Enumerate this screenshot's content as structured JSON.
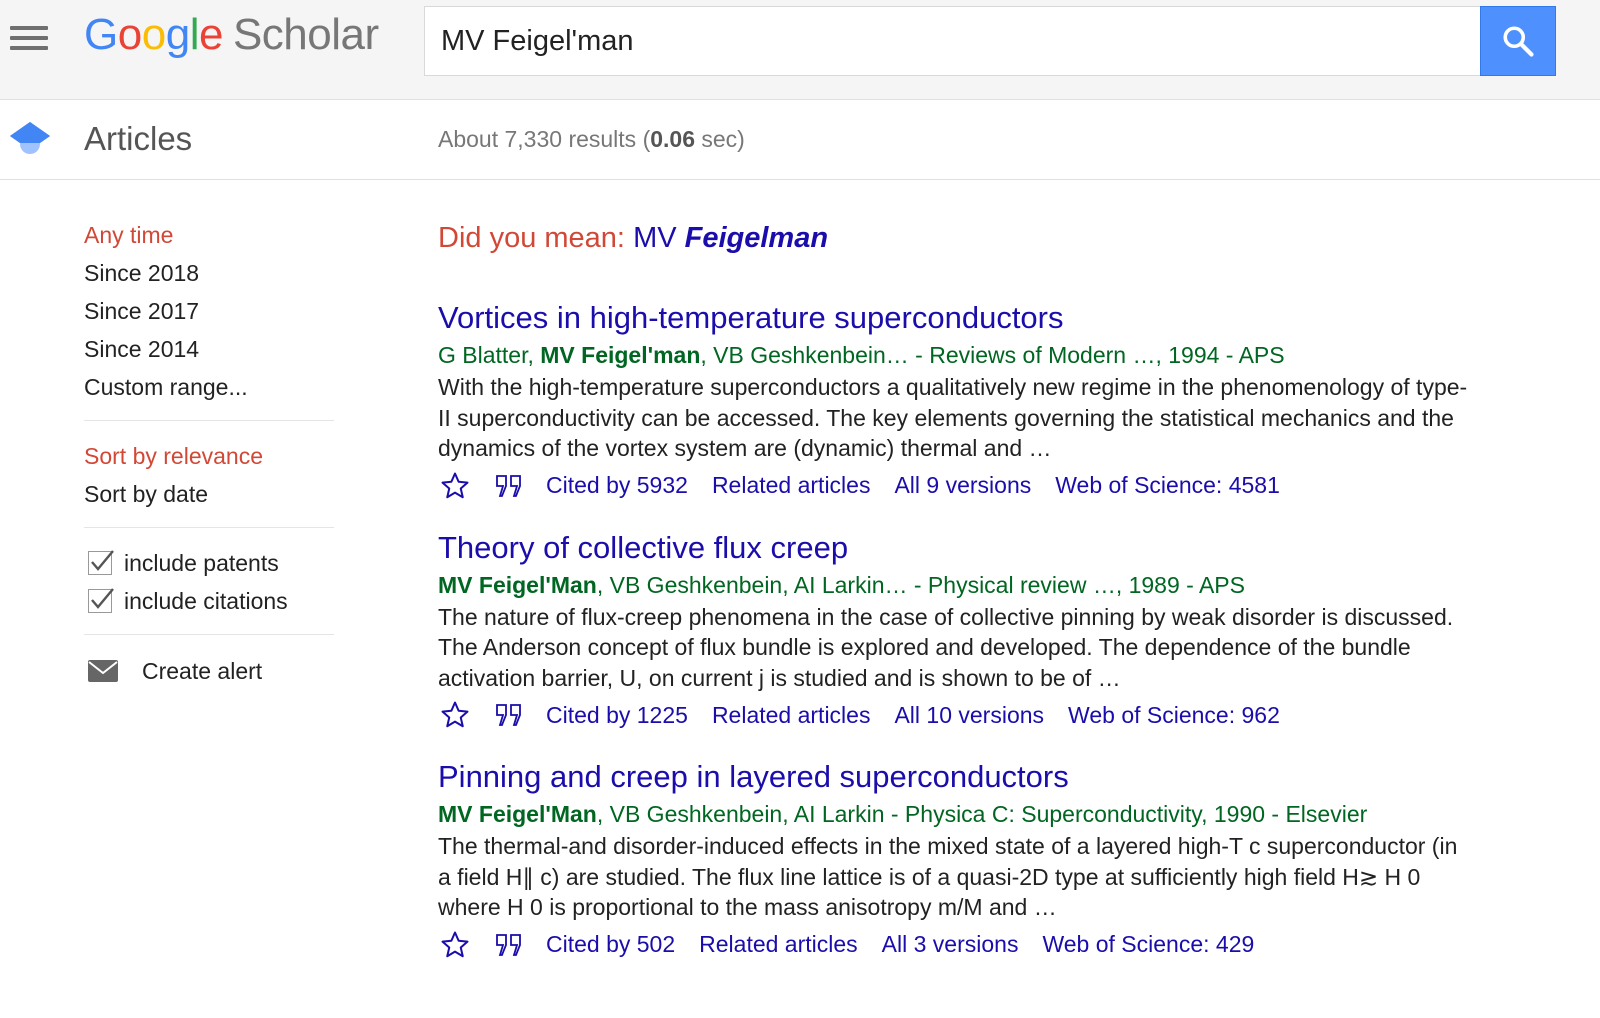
{
  "header": {
    "logo": {
      "G": "G",
      "o1": "o",
      "o2": "o",
      "g": "g",
      "l": "l",
      "e": "e",
      "product": "Scholar"
    },
    "search_query": "MV Feigel'man",
    "menu_icon": "hamburger-menu-icon",
    "search_icon": "search-icon"
  },
  "subheader": {
    "title": "Articles",
    "results_prefix": "About 7,330 results (",
    "results_time": "0.06",
    "results_suffix": " sec)"
  },
  "sidebar": {
    "time_filters": [
      "Any time",
      "Since 2018",
      "Since 2017",
      "Since 2014",
      "Custom range..."
    ],
    "sort_options": [
      "Sort by relevance",
      "Sort by date"
    ],
    "checkboxes": [
      {
        "label": "include patents",
        "checked": true
      },
      {
        "label": "include citations",
        "checked": true
      }
    ],
    "alert_label": "Create alert"
  },
  "did_you_mean": {
    "label": "Did you mean:",
    "prefix": "MV",
    "suggestion": "Feigelman"
  },
  "results": [
    {
      "title": "Vortices in high-temperature superconductors",
      "authors_before": "G Blatter, ",
      "authors_bold": "MV Feigel'man",
      "authors_after": ", VB Geshkenbein… - Reviews of Modern …, 1994 - APS",
      "snippet": "With the high-temperature superconductors a qualitatively new regime in the phenomenology of type-II superconductivity can be accessed. The key elements governing the statistical mechanics and the dynamics of the vortex system are (dynamic) thermal and …",
      "cited_by": "Cited by 5932",
      "related": "Related articles",
      "versions": "All 9 versions",
      "wos": "Web of Science: 4581"
    },
    {
      "title": "Theory of collective flux creep",
      "authors_before": "",
      "authors_bold": "MV Feigel'Man",
      "authors_after": ", VB Geshkenbein, AI Larkin… - Physical review …, 1989 - APS",
      "snippet": "The nature of flux-creep phenomena in the case of collective pinning by weak disorder is discussed. The Anderson concept of flux bundle is explored and developed. The dependence of the bundle activation barrier, U, on current j is studied and is shown to be of …",
      "cited_by": "Cited by 1225",
      "related": "Related articles",
      "versions": "All 10 versions",
      "wos": "Web of Science: 962"
    },
    {
      "title": "Pinning and creep in layered superconductors",
      "authors_before": "",
      "authors_bold": "MV Feigel'Man",
      "authors_after": ", VB Geshkenbein, AI Larkin - Physica C: Superconductivity, 1990 - Elsevier",
      "snippet": "The thermal-and disorder-induced effects in the mixed state of a layered high-T c superconductor (in a field H∥ c) are studied. The flux line lattice is of a quasi-2D type at sufficiently high field H≳ H 0 where H 0 is proportional to the mass anisotropy m/M and …",
      "cited_by": "Cited by 502",
      "related": "Related articles",
      "versions": "All 3 versions",
      "wos": "Web of Science: 429"
    }
  ],
  "colors": {
    "link": "#1a0dab",
    "meta": "#006621",
    "active": "#d14836",
    "search_button": "#4d90fe"
  }
}
